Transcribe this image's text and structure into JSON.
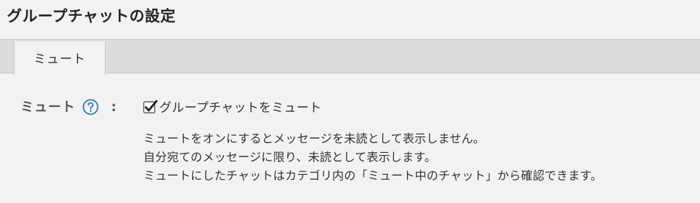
{
  "page": {
    "title": "グループチャットの設定"
  },
  "tabs": [
    {
      "label": "ミュート",
      "active": true
    }
  ],
  "setting": {
    "label": "ミュート",
    "separator": ":",
    "help_icon": "question-circle-icon",
    "checkbox": {
      "label": "グループチャットをミュート",
      "checked": true
    },
    "description": [
      "ミュートをオンにするとメッセージを未読として表示しません。",
      "自分宛てのメッセージに限り、未読として表示します。",
      "ミュートにしたチャットはカテゴリ内の「ミュート中のチャット」から確認できます。"
    ]
  },
  "colors": {
    "background": "#f2f2f2",
    "tab_bar": "#dcdcdc",
    "help_icon": "#2f80c0",
    "checkbox_check": "#222222"
  }
}
